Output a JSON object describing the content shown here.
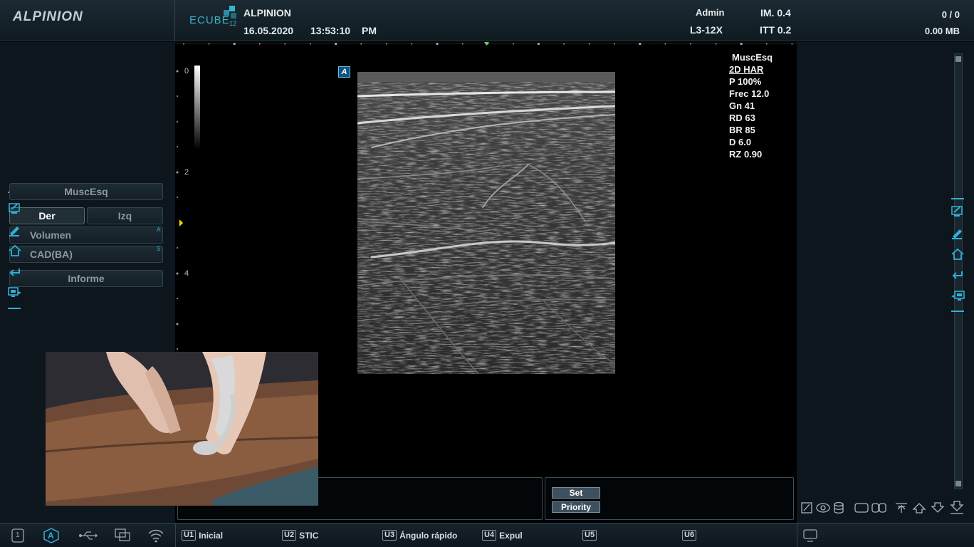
{
  "header": {
    "brand": "ALPINION",
    "product_logo": "ECUBE",
    "product_logo_sup": "12",
    "hospital": "ALPINION",
    "date": "16.05.2020",
    "time": "13:53:10",
    "ampm": "PM",
    "user": "Admin",
    "probe": "L3-12X",
    "mi": "IM. 0.4",
    "itt": "ITT 0.2",
    "count": "0 / 0",
    "storage": "0.00 MB"
  },
  "left_panel": {
    "preset_label": "MuscEsq",
    "side_right": "Der",
    "side_left": "Izq",
    "volume": "Volumen",
    "cad": "CAD(BA)",
    "report": "Informe",
    "tag_a": "A",
    "tag_s": "S"
  },
  "image": {
    "depth_labels": [
      "0",
      "2",
      "4"
    ],
    "mode_badge": "A",
    "params": {
      "preset": "MuscEsq",
      "mode": "2D HAR",
      "power": "P 100%",
      "freq": "Frec 12.0",
      "gain": "Gn 41",
      "dynamic_range": "RD 63",
      "brightness": "BR 85",
      "depth": "D 6.0",
      "zoom": "RZ 0.90"
    }
  },
  "touch_buttons": {
    "set": "Set",
    "priority": "Priority"
  },
  "footer": {
    "page_number": "1",
    "auto_label": "A",
    "keys": [
      {
        "key": "U1",
        "label": "Inicial"
      },
      {
        "key": "U2",
        "label": "STIC"
      },
      {
        "key": "U3",
        "label": "Ángulo rápido"
      },
      {
        "key": "U4",
        "label": "Expul"
      },
      {
        "key": "U5",
        "label": ""
      },
      {
        "key": "U6",
        "label": ""
      }
    ]
  },
  "colors": {
    "accent": "#2fb0d8",
    "panel_bg": "#0c161c",
    "header_bg": "#1d2a33"
  },
  "icons": {
    "left_side": [
      "tablet-pen-icon",
      "pencil-icon",
      "home-icon",
      "return-arrow-icon",
      "pc-monitor-icon"
    ],
    "right_side": [
      "tablet-pen-icon",
      "pencil-icon",
      "home-icon",
      "return-arrow-icon",
      "pc-monitor-icon"
    ],
    "tools": [
      "edit-icon",
      "eye-icon",
      "database-icon",
      "single-layout-icon",
      "dual-layout-icon",
      "upload-icon",
      "arrow-up-icon",
      "arrow-down-icon",
      "download-icon"
    ],
    "footer": [
      "page-icon",
      "auto-icon",
      "usb-icon",
      "dicom-icon",
      "wifi-icon",
      "monitor-icon"
    ]
  }
}
